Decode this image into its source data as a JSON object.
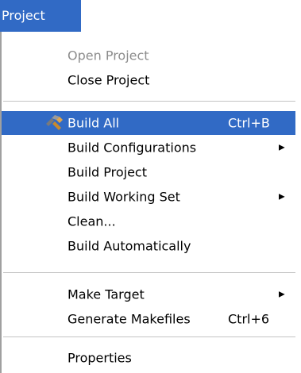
{
  "menubar": {
    "title": "Project"
  },
  "menu": {
    "items": [
      {
        "label": "Open Project",
        "shortcut": "",
        "disabled": true
      },
      {
        "label": "Close Project",
        "shortcut": ""
      },
      {
        "label": "Build All",
        "shortcut": "Ctrl+B",
        "highlighted": true,
        "icon": "hammer-icon"
      },
      {
        "label": "Build Configurations",
        "shortcut": "",
        "submenu": true
      },
      {
        "label": "Build Project",
        "shortcut": ""
      },
      {
        "label": "Build Working Set",
        "shortcut": "",
        "submenu": true
      },
      {
        "label": "Clean...",
        "shortcut": ""
      },
      {
        "label": "Build Automatically",
        "shortcut": ""
      },
      {
        "label": "Make Target",
        "shortcut": "",
        "submenu": true
      },
      {
        "label": "Generate Makefiles",
        "shortcut": "Ctrl+6"
      },
      {
        "label": "Properties",
        "shortcut": ""
      }
    ]
  },
  "colors": {
    "highlight": "#316ac5",
    "disabled_text": "#8c8c8c"
  }
}
